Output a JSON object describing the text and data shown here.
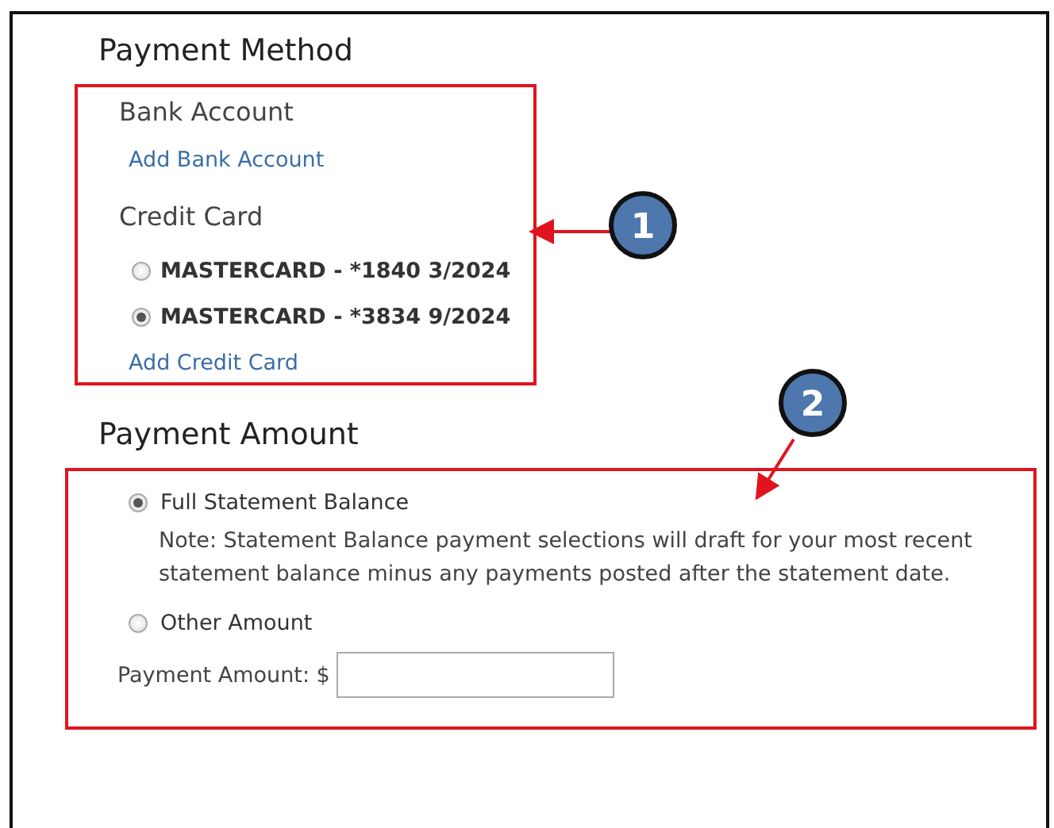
{
  "payment_method": {
    "title": "Payment Method",
    "bank_account": {
      "label": "Bank Account",
      "link": "Add Bank Account"
    },
    "credit_card": {
      "label": "Credit Card",
      "cards": [
        {
          "label": "MASTERCARD - *1840 3/2024",
          "selected": false
        },
        {
          "label": "MASTERCARD - *3834 9/2024",
          "selected": true
        }
      ],
      "link": "Add Credit Card"
    }
  },
  "payment_amount": {
    "title": "Payment Amount",
    "options": [
      {
        "label": "Full Statement Balance",
        "selected": true,
        "note": "Note: Statement Balance payment selections will draft for your most recent statement balance minus any payments posted after the statement date."
      },
      {
        "label": "Other Amount",
        "selected": false
      }
    ],
    "amount_label": "Payment Amount: $"
  },
  "callouts": [
    "1",
    "2"
  ]
}
